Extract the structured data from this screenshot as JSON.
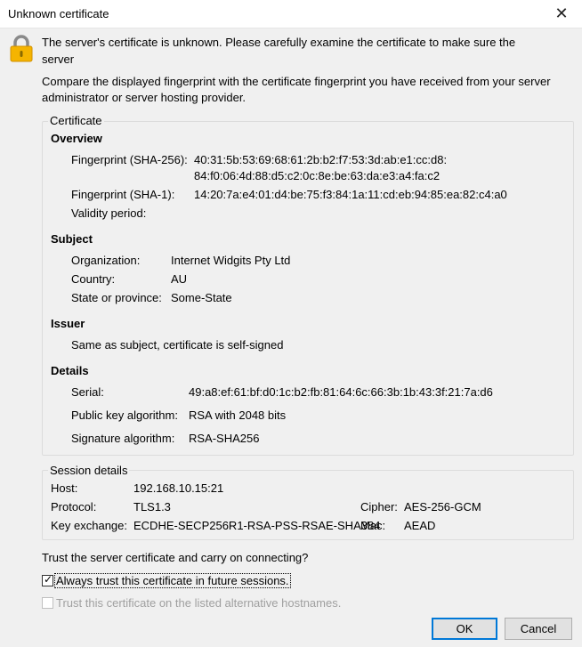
{
  "window": {
    "title": "Unknown certificate",
    "close_glyph": "✕"
  },
  "intro": {
    "line1": "The server's certificate is unknown. Please carefully examine the certificate to make sure the",
    "line1b": "server",
    "line2": "Compare the displayed fingerprint with the certificate fingerprint you have received from your server",
    "line2b": "administrator or server hosting provider."
  },
  "certificate": {
    "group_title": "Certificate",
    "overview": {
      "heading": "Overview",
      "sha256_label": "Fingerprint (SHA-256):",
      "sha256_line1": "40:31:5b:53:69:68:61:2b:b2:f7:53:3d:ab:e1:cc:d8:",
      "sha256_line2": "84:f0:06:4d:88:d5:c2:0c:8e:be:63:da:e3:a4:fa:c2",
      "sha1_label": "Fingerprint (SHA-1):",
      "sha1_value": "14:20:7a:e4:01:d4:be:75:f3:84:1a:11:cd:eb:94:85:ea:82:c4:a0",
      "validity_label": "Validity period:"
    },
    "subject": {
      "heading": "Subject",
      "org_label": "Organization:",
      "org_value": "Internet Widgits Pty Ltd",
      "country_label": "Country:",
      "country_value": "AU",
      "state_label": "State or province:",
      "state_value": "Some-State"
    },
    "issuer": {
      "heading": "Issuer",
      "text": "Same as subject, certificate is self-signed"
    },
    "details": {
      "heading": "Details",
      "serial_label": "Serial:",
      "serial_value": "49:a8:ef:61:bf:d0:1c:b2:fb:81:64:6c:66:3b:1b:43:3f:21:7a:d6",
      "pubkey_label": "Public key algorithm:",
      "pubkey_value": "RSA with 2048 bits",
      "sigalg_label": "Signature algorithm:",
      "sigalg_value": "RSA-SHA256"
    }
  },
  "session": {
    "group_title": "Session details",
    "host_label": "Host:",
    "host_value": "192.168.10.15:21",
    "protocol_label": "Protocol:",
    "protocol_value": "TLS1.3",
    "cipher_label": "Cipher:",
    "cipher_value": "AES-256-GCM",
    "kex_label": "Key exchange:",
    "kex_value": "ECDHE-SECP256R1-RSA-PSS-RSAE-SHA384",
    "mac_label": "Mac:",
    "mac_value": "AEAD"
  },
  "trust": {
    "question": "Trust the server certificate and carry on connecting?",
    "always_label": "Always trust this certificate in future sessions.",
    "always_checked": true,
    "alt_label": "Trust this certificate on the listed alternative hostnames.",
    "alt_checked": false,
    "alt_enabled": false
  },
  "buttons": {
    "ok": "OK",
    "cancel": "Cancel"
  },
  "icons": {
    "lock": "lock-icon",
    "close": "close-icon",
    "check": "checkmark-icon"
  }
}
